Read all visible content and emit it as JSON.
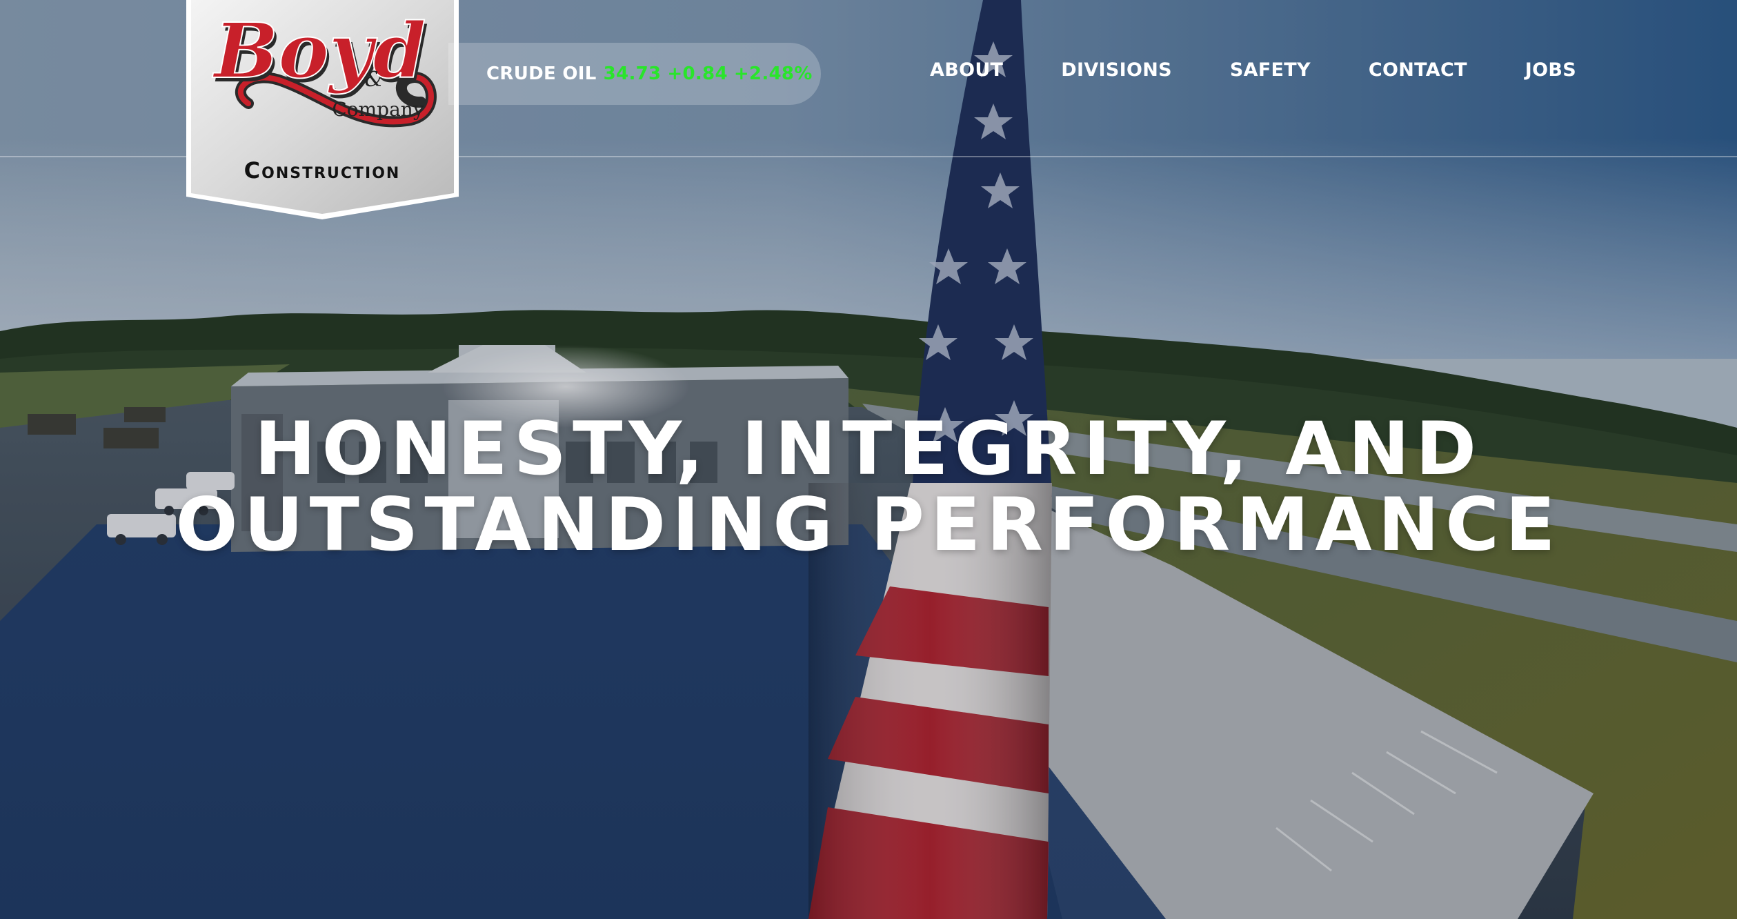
{
  "logo": {
    "script_name": "Boyd",
    "ampersand": "&",
    "company": "Company",
    "construction": "Construction"
  },
  "ticker": {
    "label": "CRUDE OIL",
    "price": "34.73",
    "change": "+0.84",
    "percent": "+2.48%"
  },
  "nav": {
    "items": [
      {
        "label": "ABOUT"
      },
      {
        "label": "DIVISIONS"
      },
      {
        "label": "SAFETY"
      },
      {
        "label": "CONTACT"
      },
      {
        "label": "JOBS"
      }
    ]
  },
  "hero": {
    "headline_line1": "HONESTY, INTEGRITY, AND",
    "headline_line2": "OUTSTANDING PERFORMANCE"
  },
  "colors": {
    "ticker_positive": "#29e52a",
    "logo_red": "#c8202a",
    "sky_blue": "#2f5f91"
  }
}
